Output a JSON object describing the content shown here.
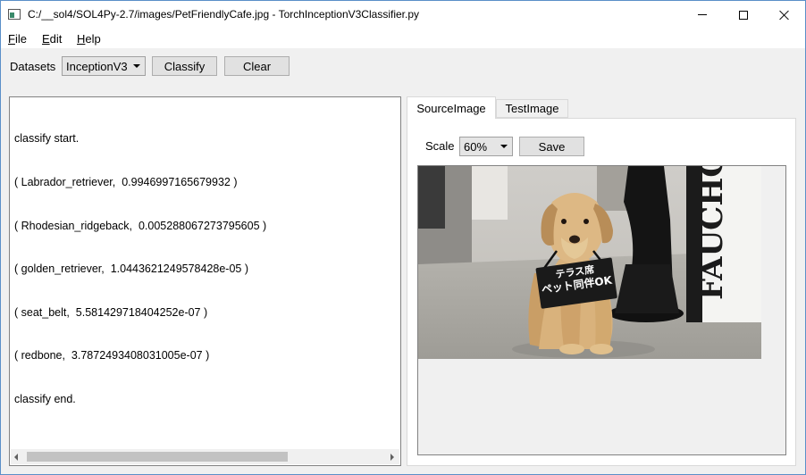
{
  "window": {
    "title": "C:/__sol4/SOL4Py-2.7/images/PetFriendlyCafe.jpg - TorchInceptionV3Classifier.py"
  },
  "menu": {
    "file_letter": "F",
    "file_rest": "ile",
    "edit_letter": "E",
    "edit_rest": "dit",
    "help_letter": "H",
    "help_rest": "elp"
  },
  "toolbar": {
    "datasets_label": "Datasets",
    "dataset_selected": "InceptionV3",
    "classify_label": "Classify",
    "clear_label": "Clear"
  },
  "output": {
    "lines": [
      "classify start.",
      "( Labrador_retriever,  0.9946997165679932 )",
      "( Rhodesian_ridgeback,  0.005288067273795605 )",
      "( golden_retriever,  1.0443621249578428e-05 )",
      "( seat_belt,  5.581429718404252e-07 )",
      "( redbone,  3.7872493408031005e-07 )",
      "classify end."
    ]
  },
  "tabs": [
    {
      "label": "SourceImage",
      "active": true
    },
    {
      "label": "TestImage",
      "active": false
    }
  ],
  "viewer": {
    "scale_label": "Scale",
    "scale_selected": "60%",
    "save_label": "Save"
  },
  "photo": {
    "sign_line1": "テラス席",
    "sign_line2": "ペット同伴OK",
    "store_text": "FAUCHON",
    "colors": {
      "floor": "#a8a6a0",
      "dog": "#d9b27c",
      "dog_shadow": "#b88d58",
      "pillar": "#101010",
      "background": "#d2d0cc"
    }
  },
  "colors": {
    "window_border": "#5a8fc8",
    "chrome": "#f0f0f0",
    "button": "#e1e1e1"
  }
}
